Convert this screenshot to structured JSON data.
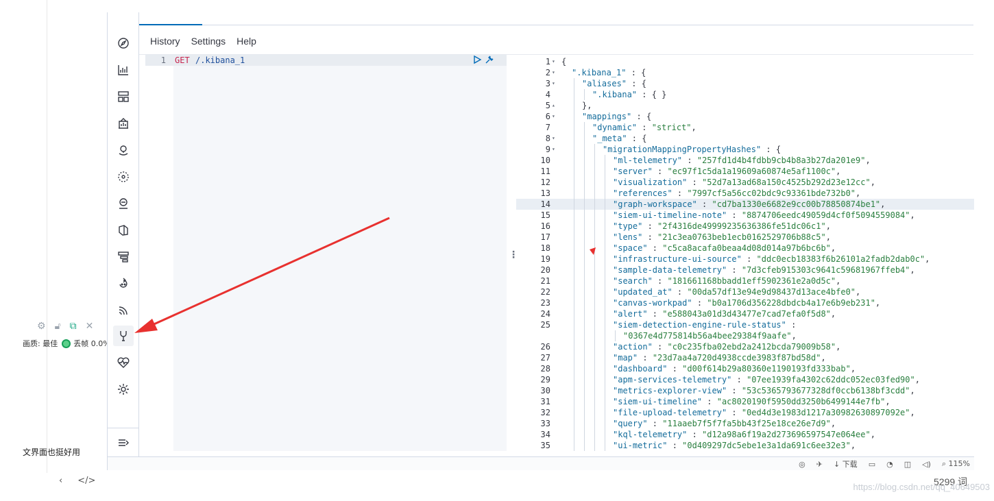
{
  "menu": {
    "history": "History",
    "settings": "Settings",
    "help": "Help"
  },
  "request": {
    "line_no": "1",
    "method": "GET",
    "path": "/.kibana_1"
  },
  "response_lines": [
    {
      "n": "1",
      "fold": "▾",
      "indent": 0,
      "t": "{"
    },
    {
      "n": "2",
      "fold": "▾",
      "indent": 1,
      "t": "\".kibana_1\" : {"
    },
    {
      "n": "3",
      "fold": "▾",
      "indent": 2,
      "t": "\"aliases\" : {"
    },
    {
      "n": "4",
      "fold": "",
      "indent": 3,
      "t": "\".kibana\" : { }"
    },
    {
      "n": "5",
      "fold": "▴",
      "indent": 2,
      "t": "},"
    },
    {
      "n": "6",
      "fold": "▾",
      "indent": 2,
      "t": "\"mappings\" : {"
    },
    {
      "n": "7",
      "fold": "",
      "indent": 3,
      "t": "\"dynamic\" : \"strict\","
    },
    {
      "n": "8",
      "fold": "▾",
      "indent": 3,
      "t": "\"_meta\" : {"
    },
    {
      "n": "9",
      "fold": "▾",
      "indent": 4,
      "t": "\"migrationMappingPropertyHashes\" : {"
    },
    {
      "n": "10",
      "fold": "",
      "indent": 5,
      "t": "\"ml-telemetry\" : \"257fd1d4b4fdbb9cb4b8a3b27da201e9\","
    },
    {
      "n": "11",
      "fold": "",
      "indent": 5,
      "t": "\"server\" : \"ec97f1c5da1a19609a60874e5af1100c\","
    },
    {
      "n": "12",
      "fold": "",
      "indent": 5,
      "t": "\"visualization\" : \"52d7a13ad68a150c4525b292d23e12cc\","
    },
    {
      "n": "13",
      "fold": "",
      "indent": 5,
      "t": "\"references\" : \"7997cf5a56cc02bdc9c93361bde732b0\","
    },
    {
      "n": "14",
      "fold": "",
      "indent": 5,
      "t": "\"graph-workspace\" : \"cd7ba1330e6682e9cc00b78850874be1\","
    },
    {
      "n": "15",
      "fold": "",
      "indent": 5,
      "t": "\"siem-ui-timeline-note\" : \"8874706eedc49059d4cf0f5094559084\","
    },
    {
      "n": "16",
      "fold": "",
      "indent": 5,
      "t": "\"type\" : \"2f4316de49999235636386fe51dc06c1\","
    },
    {
      "n": "17",
      "fold": "",
      "indent": 5,
      "t": "\"lens\" : \"21c3ea0763beb1ecb0162529706b88c5\","
    },
    {
      "n": "18",
      "fold": "",
      "indent": 5,
      "t": "\"space\" : \"c5ca8acafa0beaa4d08d014a97b6bc6b\","
    },
    {
      "n": "19",
      "fold": "",
      "indent": 5,
      "t": "\"infrastructure-ui-source\" : \"ddc0ecb18383f6b26101a2fadb2dab0c\","
    },
    {
      "n": "20",
      "fold": "",
      "indent": 5,
      "t": "\"sample-data-telemetry\" : \"7d3cfeb915303c9641c59681967ffeb4\","
    },
    {
      "n": "21",
      "fold": "",
      "indent": 5,
      "t": "\"search\" : \"181661168bbadd1eff5902361e2a0d5c\","
    },
    {
      "n": "22",
      "fold": "",
      "indent": 5,
      "t": "\"updated_at\" : \"00da57df13e94e9d98437d13ace4bfe0\","
    },
    {
      "n": "23",
      "fold": "",
      "indent": 5,
      "t": "\"canvas-workpad\" : \"b0a1706d356228dbdcb4a17e6b9eb231\","
    },
    {
      "n": "24",
      "fold": "",
      "indent": 5,
      "t": "\"alert\" : \"e588043a01d3d43477e7cad7efa0f5d8\","
    },
    {
      "n": "25",
      "fold": "",
      "indent": 5,
      "t": "\"siem-detection-engine-rule-status\" :"
    },
    {
      "n": "",
      "fold": "",
      "indent": 6,
      "t": "\"0367e4d775814b56a4bee29384f9aafe\","
    },
    {
      "n": "26",
      "fold": "",
      "indent": 5,
      "t": "\"action\" : \"c0c235fba02ebd2a2412bcda79009b58\","
    },
    {
      "n": "27",
      "fold": "",
      "indent": 5,
      "t": "\"map\" : \"23d7aa4a720d4938ccde3983f87bd58d\","
    },
    {
      "n": "28",
      "fold": "",
      "indent": 5,
      "t": "\"dashboard\" : \"d00f614b29a80360e1190193fd333bab\","
    },
    {
      "n": "29",
      "fold": "",
      "indent": 5,
      "t": "\"apm-services-telemetry\" : \"07ee1939fa4302c62ddc052ec03fed90\","
    },
    {
      "n": "30",
      "fold": "",
      "indent": 5,
      "t": "\"metrics-explorer-view\" : \"53c5365793677328df0ccb6138bf3cdd\","
    },
    {
      "n": "31",
      "fold": "",
      "indent": 5,
      "t": "\"siem-ui-timeline\" : \"ac8020190f5950dd3250b6499144e7fb\","
    },
    {
      "n": "32",
      "fold": "",
      "indent": 5,
      "t": "\"file-upload-telemetry\" : \"0ed4d3e1983d1217a30982630897092e\","
    },
    {
      "n": "33",
      "fold": "",
      "indent": 5,
      "t": "\"query\" : \"11aaeb7f5f7fa5bb43f25e18ce26e7d9\","
    },
    {
      "n": "34",
      "fold": "",
      "indent": 5,
      "t": "\"kql-telemetry\" : \"d12a98a6f19a2d273696597547e064ee\","
    },
    {
      "n": "35",
      "fold": "",
      "indent": 5,
      "t": "\"ui-metric\" : \"0d409297dc5ebe1e3a1da691c6ee32e3\","
    }
  ],
  "highlight_line": "14",
  "left_app": {
    "status_label": "画质: 最佳",
    "fps_label": "丢帧 0.0%",
    "note": "文界面也挺好用"
  },
  "status_bar": {
    "download": "下载",
    "zoom": "115%"
  },
  "word_count": "5299 词",
  "watermark": "https://blog.csdn.net/qq_40649503",
  "colors": {
    "accent": "#006bb8",
    "arrow": "#e8312f",
    "nav_active": "#f0f2f5"
  }
}
